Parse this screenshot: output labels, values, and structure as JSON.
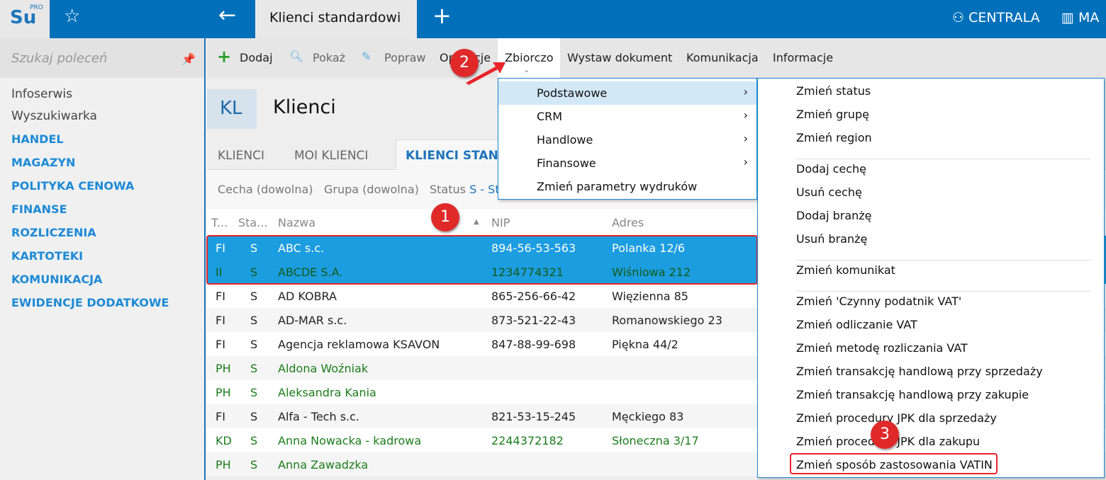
{
  "topbar": {
    "logo": "Su",
    "logo_sup": "PRO",
    "active_tab": "Klienci standardowi",
    "centrala": "CENTRALA",
    "magazyn": "MA"
  },
  "sidebar": {
    "search_placeholder": "Szukaj poleceń",
    "items": [
      "Infoserwis",
      "Wyszukiwarka"
    ],
    "categories": [
      "HANDEL",
      "MAGAZYN",
      "POLITYKA CENOWA",
      "FINANSE",
      "ROZLICZENIA",
      "KARTOTEKI",
      "KOMUNIKACJA",
      "EWIDENCJE DODATKOWE"
    ]
  },
  "toolbar": {
    "dodaj": "Dodaj",
    "pokaz": "Pokaż",
    "popraw": "Popraw",
    "operacje": "Operacje",
    "zbiorczo": "Zbiorczo",
    "wystaw": "Wystaw dokument",
    "komunikacja": "Komunikacja",
    "informacje": "Informacje"
  },
  "header": {
    "badge": "KL",
    "title": "Klienci"
  },
  "tabs": [
    "KLIENCI",
    "MOI KLIENCI",
    "KLIENCI STAN"
  ],
  "filters": {
    "cecha": "Cecha (dowolna)",
    "grupa": "Grupa (dowolna)",
    "status_label": "Status",
    "status_value": "S - St"
  },
  "table": {
    "columns": [
      "T...",
      "Sta...",
      "Nazwa",
      "NIP",
      "Adres"
    ],
    "rows": [
      {
        "t": "FI",
        "s": "S",
        "nazwa": "ABC s.c.",
        "nip": "894-56-53-563",
        "adres": "Polanka  12/6",
        "green": false,
        "selected": true
      },
      {
        "t": "II",
        "s": "S",
        "nazwa": "ABCDE S.A.",
        "nip": "1234774321",
        "adres": "Wiśniowa 212",
        "green": true,
        "selected": true
      },
      {
        "t": "FI",
        "s": "S",
        "nazwa": "AD KOBRA",
        "nip": "865-256-66-42",
        "adres": "Więzienna  85",
        "green": false
      },
      {
        "t": "FI",
        "s": "S",
        "nazwa": "AD-MAR s.c.",
        "nip": "873-521-22-43",
        "adres": "Romanowskiego 23",
        "green": false
      },
      {
        "t": "FI",
        "s": "S",
        "nazwa": "Agencja reklamowa KSAVON",
        "nip": "847-88-99-698",
        "adres": "Piękna  44/2",
        "green": false
      },
      {
        "t": "PH",
        "s": "S",
        "nazwa": "Aldona Woźniak",
        "nip": "",
        "adres": "",
        "green": true
      },
      {
        "t": "PH",
        "s": "S",
        "nazwa": "Aleksandra Kania",
        "nip": "",
        "adres": "",
        "green": true
      },
      {
        "t": "FI",
        "s": "S",
        "nazwa": "Alfa - Tech s.c.",
        "nip": "821-53-15-245",
        "adres": "Męckiego  83",
        "green": false
      },
      {
        "t": "KD",
        "s": "S",
        "nazwa": "Anna Nowacka - kadrowa",
        "nip": "2244372182",
        "adres": "Słoneczna 3/17",
        "green": true
      },
      {
        "t": "PH",
        "s": "S",
        "nazwa": "Anna Zawadzka",
        "nip": "",
        "adres": "",
        "green": true
      }
    ]
  },
  "menu": {
    "items": [
      "Podstawowe",
      "CRM",
      "Handlowe",
      "Finansowe",
      "Zmień parametry wydruków"
    ]
  },
  "submenu": {
    "groups": [
      [
        "Zmień status",
        "Zmień grupę",
        "Zmień region"
      ],
      [
        "Dodaj cechę",
        "Usuń cechę",
        "Dodaj branżę",
        "Usuń branżę"
      ],
      [
        "Zmień komunikat"
      ],
      [
        "Zmień 'Czynny podatnik VAT'",
        "Zmień odliczanie VAT",
        "Zmień metodę rozliczania VAT",
        "Zmień transakcję handlową przy sprzedaży",
        "Zmień transakcję handlową przy zakupie",
        "Zmień procedury JPK dla sprzedaży",
        "Zmień procedury JPK dla zakupu",
        "Zmień sposób zastosowania VATIN"
      ]
    ]
  },
  "annotations": [
    "1",
    "2",
    "3"
  ],
  "colors": {
    "brand": "#0070ba",
    "selection": "#1b9de0",
    "highlight": "#e8232a",
    "green_text": "#1b7d1b"
  }
}
